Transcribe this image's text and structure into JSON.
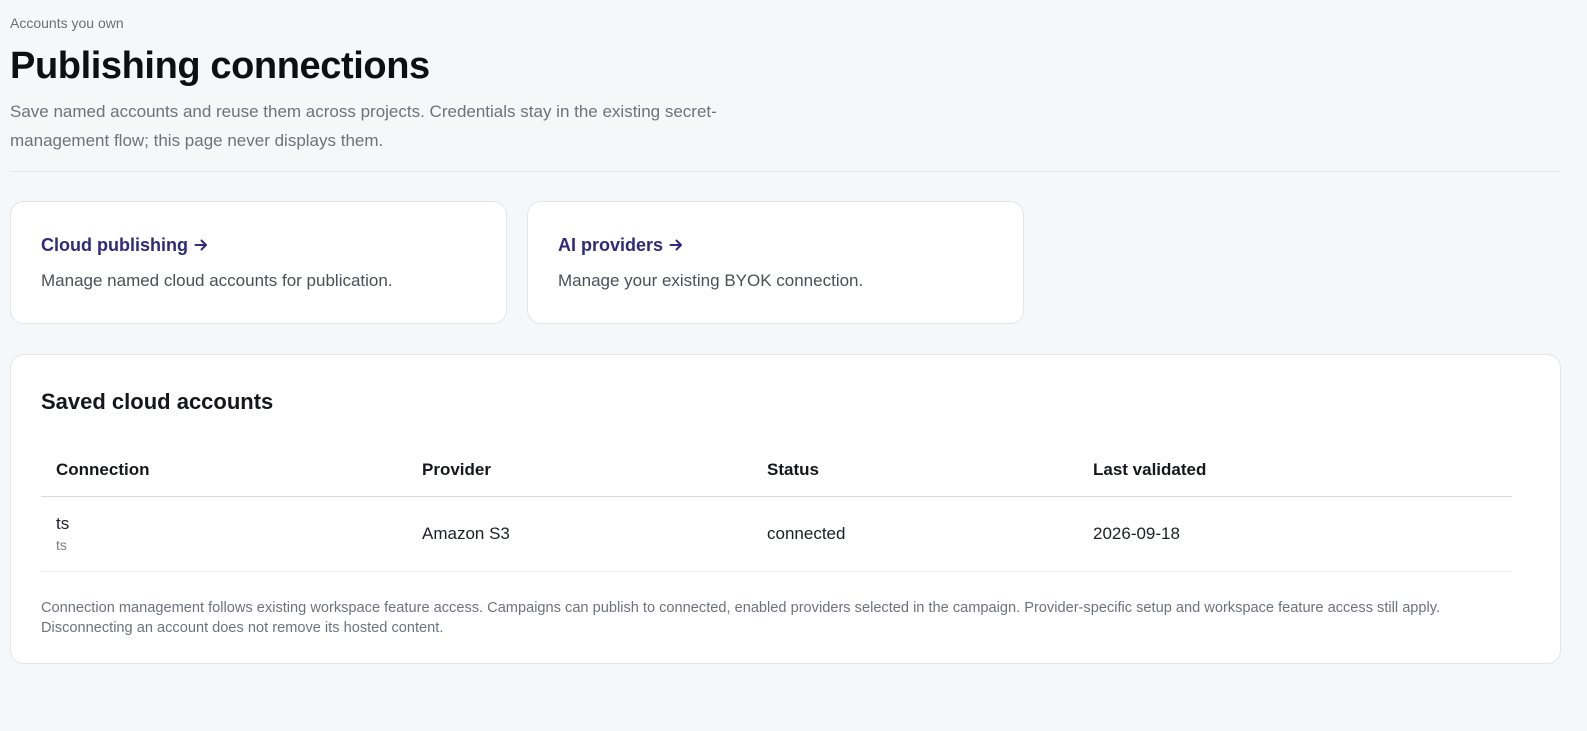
{
  "header": {
    "eyebrow": "Accounts you own",
    "title": "Publishing connections",
    "subtitle": "Save named accounts and reuse them across projects. Credentials stay in the existing secret-management flow; this page never displays them."
  },
  "cards": [
    {
      "label": "Cloud publishing",
      "icon": "arrow-right-icon",
      "description": "Manage named cloud accounts for publication."
    },
    {
      "label": "AI providers",
      "icon": "arrow-right-icon",
      "description": "Manage your existing BYOK connection."
    }
  ],
  "saved_accounts": {
    "title": "Saved cloud accounts",
    "columns": [
      "Connection",
      "Provider",
      "Status",
      "Last validated"
    ],
    "rows": [
      {
        "connection_name": "ts",
        "connection_id": "ts",
        "provider": "Amazon S3",
        "status": "connected",
        "last_validated": "2026-09-18"
      }
    ],
    "footnote": "Connection management follows existing workspace feature access. Campaigns can publish to connected, enabled providers selected in the campaign. Provider-specific setup and workspace feature access still apply. Disconnecting an account does not remove its hosted content."
  },
  "colors": {
    "background": "#f6f7f9",
    "link": "#2f2a7a",
    "card_border": "#e3e5e9"
  }
}
